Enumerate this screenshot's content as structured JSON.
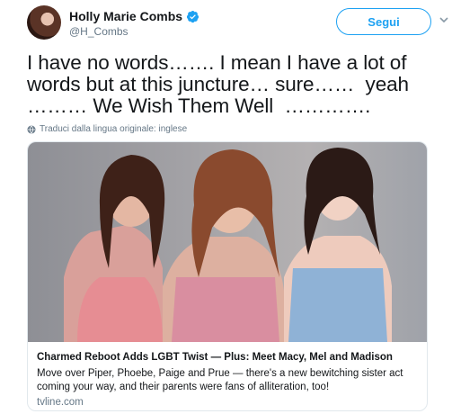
{
  "author": {
    "display_name": "Holly Marie Combs",
    "handle": "@H_Combs",
    "verified_icon": "verified-badge-icon",
    "avatar_icon": "avatar"
  },
  "follow_button": {
    "label": "Segui"
  },
  "tweet": {
    "text": "I have no words……. I mean I have a lot of words but at this juncture… sure……  yeah ……… We Wish Them Well  …………."
  },
  "translate": {
    "label": "Traduci dalla lingua originale: inglese"
  },
  "card": {
    "title": "Charmed Reboot Adds LGBT Twist — Plus: Meet Macy, Mel and Madison",
    "description": "Move over Piper, Phoebe, Paige and Prue — there's a new bewitching sister act coming your way, and their parents were fans of alliteration, too!",
    "domain": "tvline.com"
  },
  "colors": {
    "accent": "#1da1f2",
    "text_primary": "#14171a",
    "text_secondary": "#657786",
    "border": "#e1e8ed"
  }
}
